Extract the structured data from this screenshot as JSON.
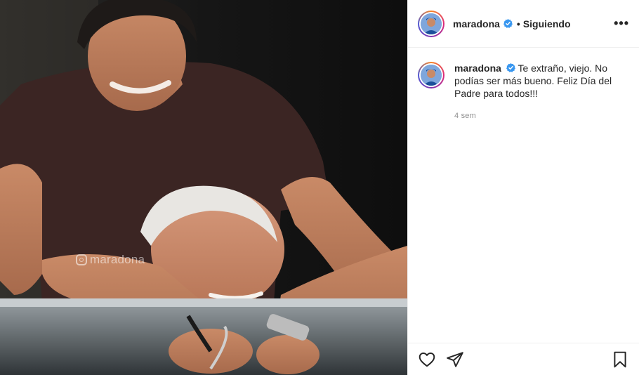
{
  "post": {
    "username": "maradona",
    "follow_status": "Siguiendo",
    "dot": "•",
    "more": "•••",
    "caption": "Te extraño, viejo. No podías ser más bueno. Feliz Día del Padre para todos!!!",
    "time": "4 sem",
    "watermark": "maradona",
    "icons": [
      "verified-badge-icon",
      "more-options-icon",
      "heart-icon",
      "share-icon",
      "bookmark-icon"
    ],
    "colors": {
      "verified": "#3897f0",
      "secondary_text": "#8e8e8e",
      "border": "#efefef"
    }
  }
}
